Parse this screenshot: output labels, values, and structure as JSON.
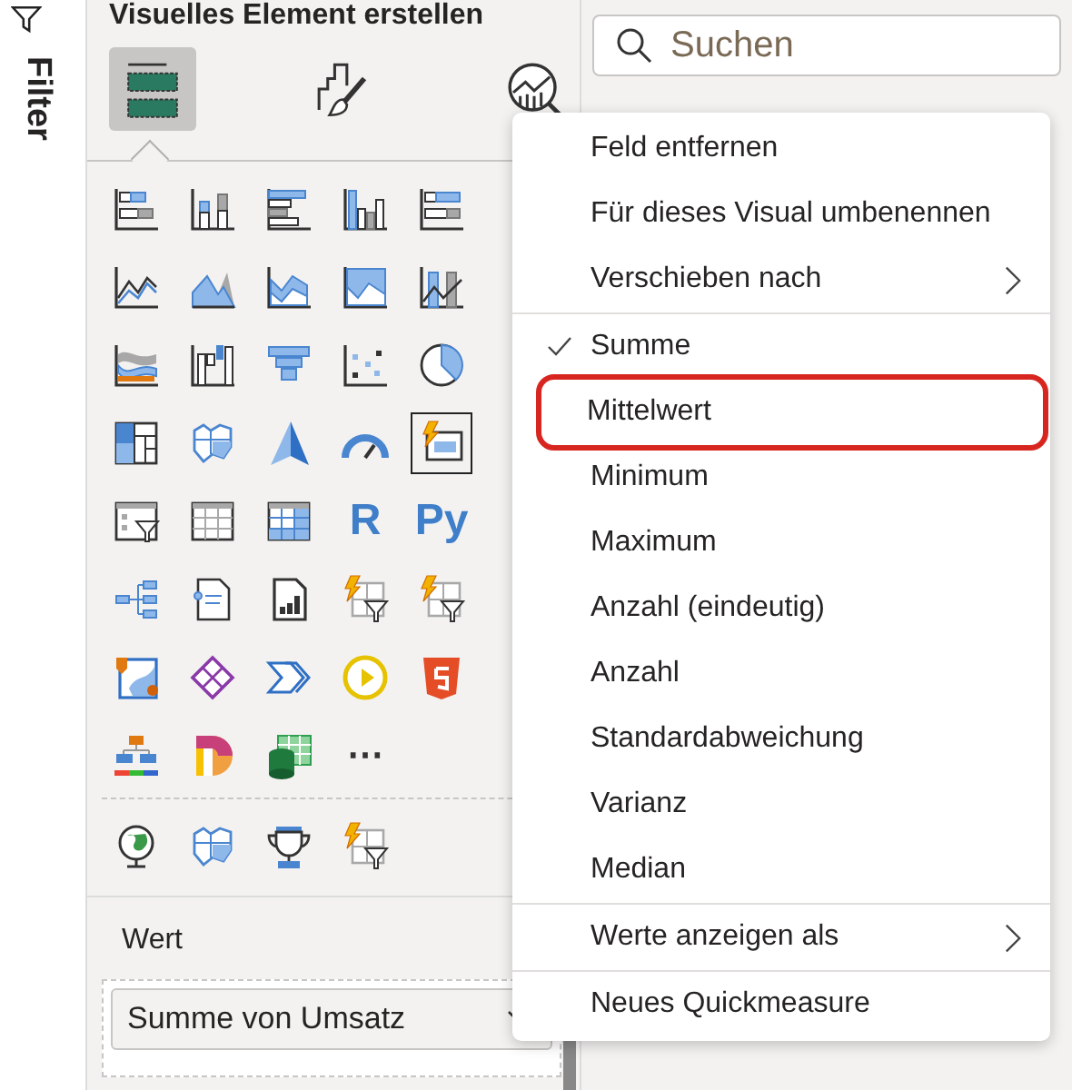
{
  "filter_pane": {
    "label": "Filter"
  },
  "visualizations": {
    "title": "Visuelles Element erstellen",
    "tabs": [
      {
        "kind": "build",
        "selected": true
      },
      {
        "kind": "format",
        "selected": false
      },
      {
        "kind": "analytics",
        "selected": false
      }
    ],
    "gallery": [
      {
        "kind": "hbar",
        "selected": false
      },
      {
        "kind": "vbar",
        "selected": false
      },
      {
        "kind": "hbar2",
        "selected": false
      },
      {
        "kind": "vbar2",
        "selected": false
      },
      {
        "kind": "hbar3",
        "selected": false
      },
      {
        "kind": "line",
        "selected": false
      },
      {
        "kind": "area",
        "selected": false
      },
      {
        "kind": "area2",
        "selected": false
      },
      {
        "kind": "area3",
        "selected": false
      },
      {
        "kind": "combo",
        "selected": false
      },
      {
        "kind": "ribbon",
        "selected": false
      },
      {
        "kind": "waterfall",
        "selected": false
      },
      {
        "kind": "funnel",
        "selected": false
      },
      {
        "kind": "scatter",
        "selected": false
      },
      {
        "kind": "pie",
        "selected": false
      },
      {
        "kind": "treemap",
        "selected": false
      },
      {
        "kind": "map",
        "selected": false
      },
      {
        "kind": "arrow",
        "selected": false
      },
      {
        "kind": "gauge",
        "selected": false
      },
      {
        "kind": "card",
        "selected": true
      },
      {
        "kind": "slicer",
        "selected": false
      },
      {
        "kind": "table",
        "selected": false
      },
      {
        "kind": "matrix",
        "selected": false
      },
      {
        "kind": "script",
        "label": "R",
        "selected": false
      },
      {
        "kind": "script",
        "label": "Py",
        "selected": false
      },
      {
        "kind": "tree",
        "selected": false
      },
      {
        "kind": "narrative",
        "selected": false
      },
      {
        "kind": "paginated",
        "selected": false
      },
      {
        "kind": "boltfilter",
        "selected": false
      },
      {
        "kind": "boltfilter",
        "selected": false
      },
      {
        "kind": "pinmap",
        "selected": false
      },
      {
        "kind": "diamond",
        "selected": false
      },
      {
        "kind": "chevron",
        "selected": false
      },
      {
        "kind": "play",
        "selected": false
      },
      {
        "kind": "shield",
        "selected": false
      },
      {
        "kind": "org",
        "selected": false
      },
      {
        "kind": "dlogo",
        "selected": false
      },
      {
        "kind": "sheet",
        "selected": false
      },
      {
        "kind": "more",
        "label": "⋯",
        "selected": false
      }
    ],
    "custom": [
      {
        "kind": "globe",
        "selected": false
      },
      {
        "kind": "map",
        "selected": false
      },
      {
        "kind": "trophy",
        "selected": false
      },
      {
        "kind": "boltfilter",
        "selected": false
      }
    ],
    "well": {
      "label": "Wert",
      "field": "Summe von Umsatz"
    }
  },
  "search": {
    "placeholder": "Suchen"
  },
  "context_menu": {
    "groups": [
      [
        {
          "label": "Feld entfernen",
          "checked": false,
          "submenu": false,
          "highlighted": false
        },
        {
          "label": "Für dieses Visual umbenennen",
          "checked": false,
          "submenu": false,
          "highlighted": false
        },
        {
          "label": "Verschieben nach",
          "checked": false,
          "submenu": true,
          "highlighted": false
        }
      ],
      [
        {
          "label": "Summe",
          "checked": true,
          "submenu": false,
          "highlighted": false
        },
        {
          "label": "Mittelwert",
          "checked": false,
          "submenu": false,
          "highlighted": true
        },
        {
          "label": "Minimum",
          "checked": false,
          "submenu": false,
          "highlighted": false
        },
        {
          "label": "Maximum",
          "checked": false,
          "submenu": false,
          "highlighted": false
        },
        {
          "label": "Anzahl (eindeutig)",
          "checked": false,
          "submenu": false,
          "highlighted": false
        },
        {
          "label": "Anzahl",
          "checked": false,
          "submenu": false,
          "highlighted": false
        },
        {
          "label": "Standardabweichung",
          "checked": false,
          "submenu": false,
          "highlighted": false
        },
        {
          "label": "Varianz",
          "checked": false,
          "submenu": false,
          "highlighted": false
        },
        {
          "label": "Median",
          "checked": false,
          "submenu": false,
          "highlighted": false
        }
      ],
      [
        {
          "label": "Werte anzeigen als",
          "checked": false,
          "submenu": true,
          "highlighted": false
        }
      ],
      [
        {
          "label": "Neues Quickmeasure",
          "checked": false,
          "submenu": false,
          "highlighted": false
        }
      ]
    ]
  }
}
